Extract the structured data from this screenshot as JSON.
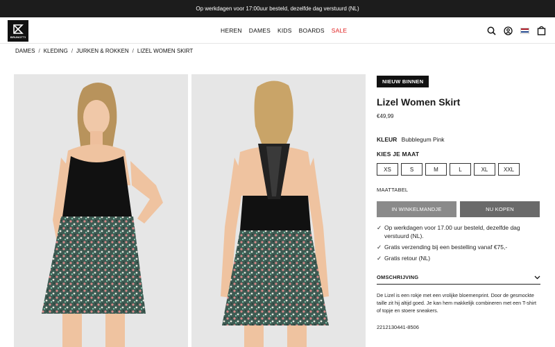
{
  "announcement": "Op werkdagen voor 17:00uur besteld, dezelfde dag verstuurd (NL)",
  "brand": {
    "logo_text": "BRUNOTTI"
  },
  "nav": {
    "items": [
      "HEREN",
      "DAMES",
      "KIDS",
      "BOARDS"
    ],
    "sale": "SALE",
    "sale_color": "#e02020"
  },
  "header_icons": [
    "search-icon",
    "account-icon",
    "flag-nl-icon",
    "cart-icon"
  ],
  "breadcrumb": [
    "DAMES",
    "KLEDING",
    "JURKEN & ROKKEN",
    "LIZEL WOMEN SKIRT"
  ],
  "product": {
    "badge": "NIEUW BINNEN",
    "title": "Lizel Women Skirt",
    "price": "€49,99",
    "color_label": "KLEUR",
    "color_value": "Bubblegum Pink",
    "size_heading": "KIES JE MAAT",
    "sizes": [
      "XS",
      "S",
      "M",
      "L",
      "XL",
      "XXL"
    ],
    "size_chart": "MAATTABEL",
    "add_to_cart": "IN WINKELMANDJE",
    "buy_now": "NU KOPEN",
    "usps": [
      "Op werkdagen voor 17.00 uur besteld, dezelfde dag verstuurd (NL).",
      "Gratis verzending bij een bestelling vanaf €75,-",
      "Gratis retour (NL)"
    ],
    "description_heading": "OMSCHRIJVING",
    "description": "De Lizel is een rokje met een vrolijke bloemenprint. Door de gesmockte taille zit hij altijd goed. Je kan hem makkelijk combineren met een T-shirt of topje en stoere sneakers.",
    "sku": "2212130441-8506"
  }
}
